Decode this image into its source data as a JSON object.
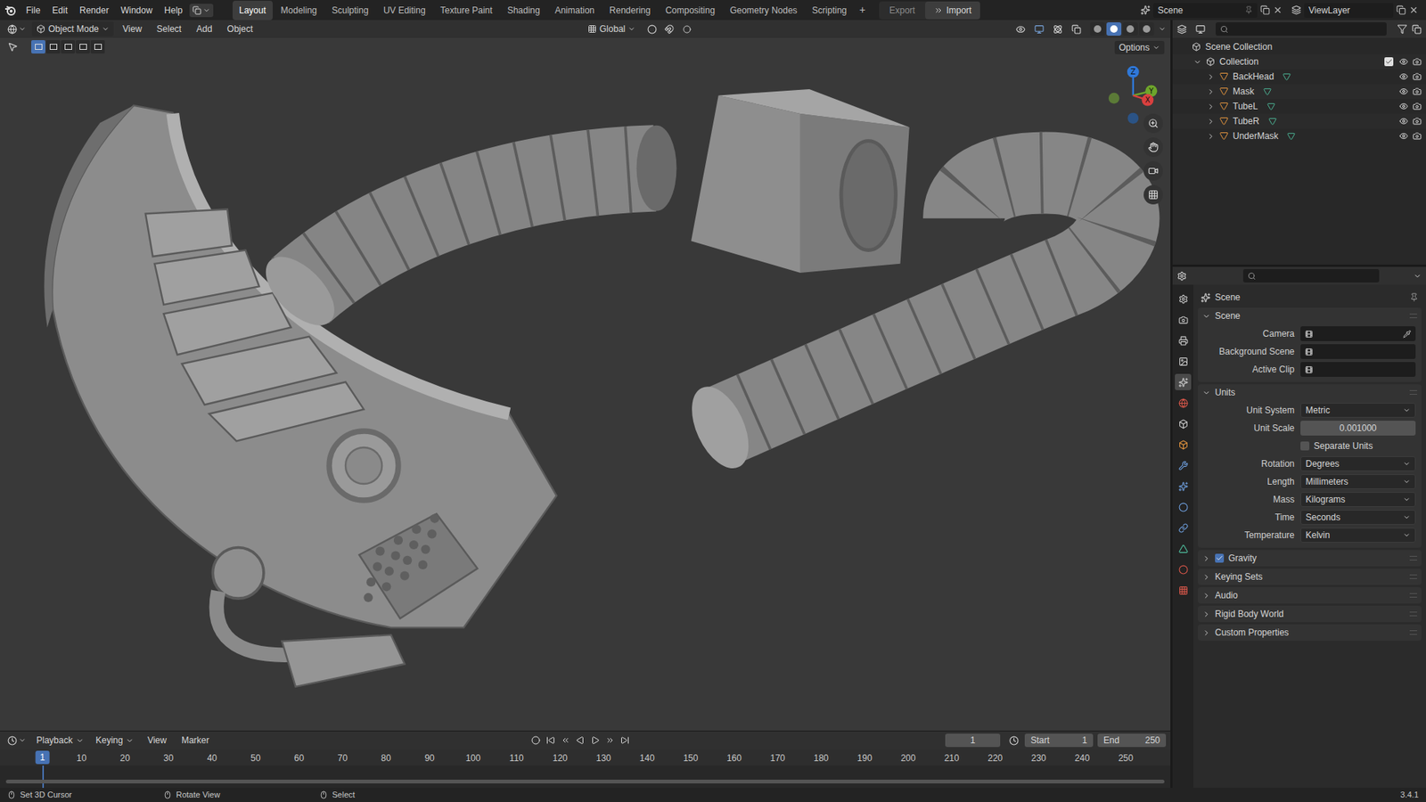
{
  "topbar": {
    "menus": [
      "File",
      "Edit",
      "Render",
      "Window",
      "Help"
    ],
    "workspaces": [
      {
        "label": "Layout",
        "selected": true
      },
      {
        "label": "Modeling",
        "selected": false
      },
      {
        "label": "Sculpting",
        "selected": false
      },
      {
        "label": "UV Editing",
        "selected": false
      },
      {
        "label": "Texture Paint",
        "selected": false
      },
      {
        "label": "Shading",
        "selected": false
      },
      {
        "label": "Animation",
        "selected": false
      },
      {
        "label": "Rendering",
        "selected": false
      },
      {
        "label": "Compositing",
        "selected": false
      },
      {
        "label": "Geometry Nodes",
        "selected": false
      },
      {
        "label": "Scripting",
        "selected": false
      }
    ],
    "add_workspace": "+",
    "export": "Export",
    "import": "Import",
    "scene": "Scene",
    "view_layer": "ViewLayer"
  },
  "viewport": {
    "mode": "Object Mode",
    "menus": [
      "View",
      "Select",
      "Add",
      "Object"
    ],
    "orientation": "Global",
    "options": "Options",
    "shading": [
      {
        "selected": false
      },
      {
        "selected": true
      },
      {
        "selected": false
      },
      {
        "selected": false
      }
    ],
    "gizmo_axes": [
      {
        "label": "Z",
        "color": "#2f78d8"
      },
      {
        "label": "Y",
        "color": "#6ea52b"
      },
      {
        "label": "X",
        "color": "#d9403f"
      }
    ]
  },
  "outliner": {
    "root": "Scene Collection",
    "collection": {
      "name": "Collection",
      "expanded": true,
      "checked": true,
      "visible": true
    },
    "objects": [
      {
        "name": "BackHead",
        "expanded": false,
        "visible": true
      },
      {
        "name": "Mask",
        "expanded": false,
        "visible": true
      },
      {
        "name": "TubeL",
        "expanded": false,
        "visible": true
      },
      {
        "name": "TubeR",
        "expanded": false,
        "visible": true
      },
      {
        "name": "UnderMask",
        "expanded": false,
        "visible": true
      }
    ]
  },
  "properties": {
    "icon_tabs": [
      {
        "selected": false
      },
      {
        "selected": false
      },
      {
        "selected": false
      },
      {
        "selected": false
      },
      {
        "selected": true
      },
      {
        "selected": false
      },
      {
        "selected": false
      },
      {
        "selected": false
      },
      {
        "selected": false
      },
      {
        "selected": false
      },
      {
        "selected": false
      },
      {
        "selected": false
      },
      {
        "selected": false
      },
      {
        "selected": false
      },
      {
        "selected": false
      }
    ],
    "title": "Scene",
    "sections": [
      {
        "title": "Scene",
        "expanded": true,
        "has_checkbox": false,
        "checked": false,
        "rows": [
          {
            "label": "Camera",
            "kind": "picker",
            "value": "",
            "eyedropper": true
          },
          {
            "label": "Background Scene",
            "kind": "picker",
            "value": "",
            "eyedropper": false
          },
          {
            "label": "Active Clip",
            "kind": "picker",
            "value": "",
            "eyedropper": false
          }
        ]
      },
      {
        "title": "Units",
        "expanded": true,
        "has_checkbox": false,
        "checked": false,
        "rows": [
          {
            "label": "Unit System",
            "kind": "dropdown",
            "value": "Metric"
          },
          {
            "label": "Unit Scale",
            "kind": "number",
            "value": "0.001000"
          },
          {
            "label": "Separate Units",
            "kind": "checkbox",
            "checked": false
          },
          {
            "label": "Rotation",
            "kind": "dropdown",
            "value": "Degrees"
          },
          {
            "label": "Length",
            "kind": "dropdown",
            "value": "Millimeters"
          },
          {
            "label": "Mass",
            "kind": "dropdown",
            "value": "Kilograms"
          },
          {
            "label": "Time",
            "kind": "dropdown",
            "value": "Seconds"
          },
          {
            "label": "Temperature",
            "kind": "dropdown",
            "value": "Kelvin"
          }
        ]
      },
      {
        "title": "Gravity",
        "expanded": false,
        "has_checkbox": true,
        "checked": true,
        "rows": []
      },
      {
        "title": "Keying Sets",
        "expanded": false,
        "has_checkbox": false,
        "checked": false,
        "rows": []
      },
      {
        "title": "Audio",
        "expanded": false,
        "has_checkbox": false,
        "checked": false,
        "rows": []
      },
      {
        "title": "Rigid Body World",
        "expanded": false,
        "has_checkbox": false,
        "checked": false,
        "rows": []
      },
      {
        "title": "Custom Properties",
        "expanded": false,
        "has_checkbox": false,
        "checked": false,
        "rows": []
      }
    ]
  },
  "timeline": {
    "menus": [
      "Playback",
      "Keying",
      "View",
      "Marker"
    ],
    "current_frame": "1",
    "start_label": "Start",
    "start": "1",
    "end_label": "End",
    "end": "250",
    "ticks": [
      "10",
      "20",
      "30",
      "40",
      "50",
      "60",
      "70",
      "80",
      "90",
      "100",
      "110",
      "120",
      "130",
      "140",
      "150",
      "160",
      "170",
      "180",
      "190",
      "200",
      "210",
      "220",
      "230",
      "240",
      "250"
    ],
    "playhead": "1"
  },
  "status_bar": {
    "hints": [
      "Set 3D Cursor",
      "Rotate View",
      "Select"
    ],
    "version": "3.4.1"
  }
}
